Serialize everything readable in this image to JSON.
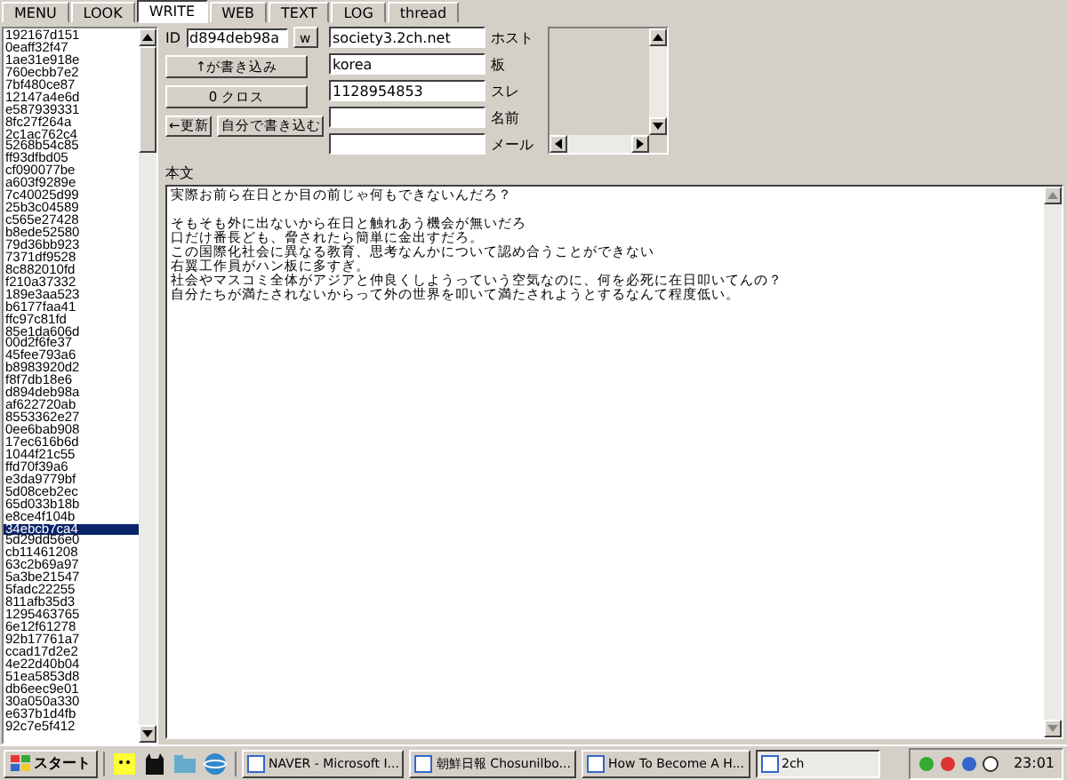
{
  "tabs": [
    {
      "label": "MENU",
      "selected": false
    },
    {
      "label": "LOOK",
      "selected": false
    },
    {
      "label": "WRITE",
      "selected": true
    },
    {
      "label": "WEB",
      "selected": false
    },
    {
      "label": "TEXT",
      "selected": false
    },
    {
      "label": "LOG",
      "selected": false
    },
    {
      "label": "thread",
      "selected": false
    }
  ],
  "id_list": [
    {
      "label": "192167d151",
      "selected": false
    },
    {
      "label": "0eaff32f47",
      "selected": false
    },
    {
      "label": "1ae31e918e",
      "selected": false
    },
    {
      "label": "760ecbb7e2",
      "selected": false
    },
    {
      "label": "7bf480ce87",
      "selected": false
    },
    {
      "label": "12147a4e6d",
      "selected": false
    },
    {
      "label": "e587939331",
      "selected": false
    },
    {
      "label": "8fc27f264a",
      "selected": false
    },
    {
      "label": "2c1ac762c4",
      "selected": false
    },
    {
      "label": "5268b54c85",
      "selected": false
    },
    {
      "label": "ff93dfbd05",
      "selected": false
    },
    {
      "label": "cf090077be",
      "selected": false
    },
    {
      "label": "a603f9289e",
      "selected": false
    },
    {
      "label": "7c40025d99",
      "selected": false
    },
    {
      "label": "25b3c04589",
      "selected": false
    },
    {
      "label": "c565e27428",
      "selected": false
    },
    {
      "label": "b8ede52580",
      "selected": false
    },
    {
      "label": "79d36bb923",
      "selected": false
    },
    {
      "label": "7371df9528",
      "selected": false
    },
    {
      "label": "8c882010fd",
      "selected": false
    },
    {
      "label": "f210a37332",
      "selected": false
    },
    {
      "label": "189e3aa523",
      "selected": false
    },
    {
      "label": "b6177faa41",
      "selected": false
    },
    {
      "label": "ffc97c81fd",
      "selected": false
    },
    {
      "label": "85e1da606d",
      "selected": false
    },
    {
      "label": "00d2f6fe37",
      "selected": false
    },
    {
      "label": "45fee793a6",
      "selected": false
    },
    {
      "label": "b8983920d2",
      "selected": false
    },
    {
      "label": "f8f7db18e6",
      "selected": false
    },
    {
      "label": "d894deb98a",
      "selected": false
    },
    {
      "label": "af622720ab",
      "selected": false
    },
    {
      "label": "8553362e27",
      "selected": false
    },
    {
      "label": "0ee6bab908",
      "selected": false
    },
    {
      "label": "17ec616b6d",
      "selected": false
    },
    {
      "label": "1044f21c55",
      "selected": false
    },
    {
      "label": "ffd70f39a6",
      "selected": false
    },
    {
      "label": "e3da9779bf",
      "selected": false
    },
    {
      "label": "5d08ceb2ec",
      "selected": false
    },
    {
      "label": "65d033b18b",
      "selected": false
    },
    {
      "label": "e8ce4f104b",
      "selected": false
    },
    {
      "label": "34ebcb7ca4",
      "selected": true
    },
    {
      "label": "5d29dd56e0",
      "selected": false
    },
    {
      "label": "cb11461208",
      "selected": false
    },
    {
      "label": "63c2b69a97",
      "selected": false
    },
    {
      "label": "5a3be21547",
      "selected": false
    },
    {
      "label": "5fadc22255",
      "selected": false
    },
    {
      "label": "811afb35d3",
      "selected": false
    },
    {
      "label": "1295463765",
      "selected": false
    },
    {
      "label": "6e12f61278",
      "selected": false
    },
    {
      "label": "92b17761a7",
      "selected": false
    },
    {
      "label": "ccad17d2e2",
      "selected": false
    },
    {
      "label": "4e22d40b04",
      "selected": false
    },
    {
      "label": "51ea5853d8",
      "selected": false
    },
    {
      "label": "db6eec9e01",
      "selected": false
    },
    {
      "label": "30a050a330",
      "selected": false
    },
    {
      "label": "e637b1d4fb",
      "selected": false
    },
    {
      "label": "92c7e5f412",
      "selected": false
    }
  ],
  "form": {
    "id_label": "ID",
    "id_value": "d894deb98a",
    "w_button": "w",
    "write_above_button": "↑が書き込み",
    "cross_button": "0 クロス",
    "refresh_button": "←更新",
    "self_write_button": "自分で書き込む",
    "fields": [
      {
        "label": "ホスト",
        "value": "society3.2ch.net"
      },
      {
        "label": "板",
        "value": "korea"
      },
      {
        "label": "スレ",
        "value": "1128954853"
      },
      {
        "label": "名前"
      },
      {
        "label": "メール"
      }
    ]
  },
  "body": {
    "label": "本文",
    "paragraphs": [
      [
        "実際お前ら在日とか目の前じゃ何もできないんだろ？"
      ],
      [
        "そもそも外に出ないから在日と触れあう機会が無いだろ",
        "口だけ番長ども、脅されたら簡単に金出すだろ。",
        "この国際化社会に異なる教育、思考なんかについて認め合うことができない",
        "右翼工作員がハン板に多すぎ。",
        "社会やマスコミ全体がアジアと仲良くしようっていう空気なのに、何を必死に在日叩いてんの？",
        "自分たちが満たされないからって外の世界を叩いて満たされようとするなんて程度低い。"
      ]
    ]
  },
  "taskbar": {
    "start": "スタート",
    "tasks": [
      {
        "label": "NAVER - Microsoft I...",
        "selected": false
      },
      {
        "label": "朝鮮日報 Chosunilbo...",
        "selected": false
      },
      {
        "label": "How To Become A H...",
        "selected": false
      },
      {
        "label": "2ch",
        "selected": true
      }
    ],
    "clock": "23:01"
  }
}
